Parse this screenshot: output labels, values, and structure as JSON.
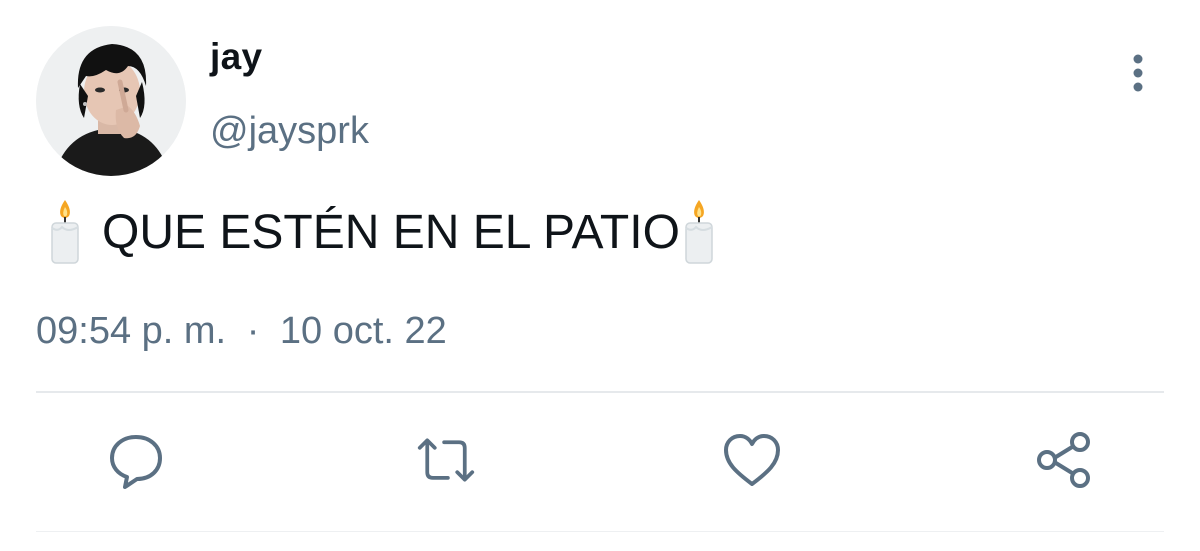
{
  "user": {
    "display_name": "jay",
    "handle": "@jaysprk"
  },
  "tweet": {
    "text": "QUE ESTÉN EN EL PATIO",
    "leading_emoji": "candle-emoji",
    "trailing_emoji": "candle-emoji",
    "time": "09:54 p. m.",
    "separator": "·",
    "date": "10 oct. 22"
  },
  "actions": {
    "reply_icon": "speech-bubble-icon",
    "retweet_icon": "retweet-icon",
    "like_icon": "heart-icon",
    "share_icon": "share-icon",
    "more_icon": "vertical-ellipsis-icon"
  },
  "colors": {
    "text_primary": "#0f1419",
    "text_secondary": "#5b7083",
    "divider": "#e6e9ec"
  }
}
